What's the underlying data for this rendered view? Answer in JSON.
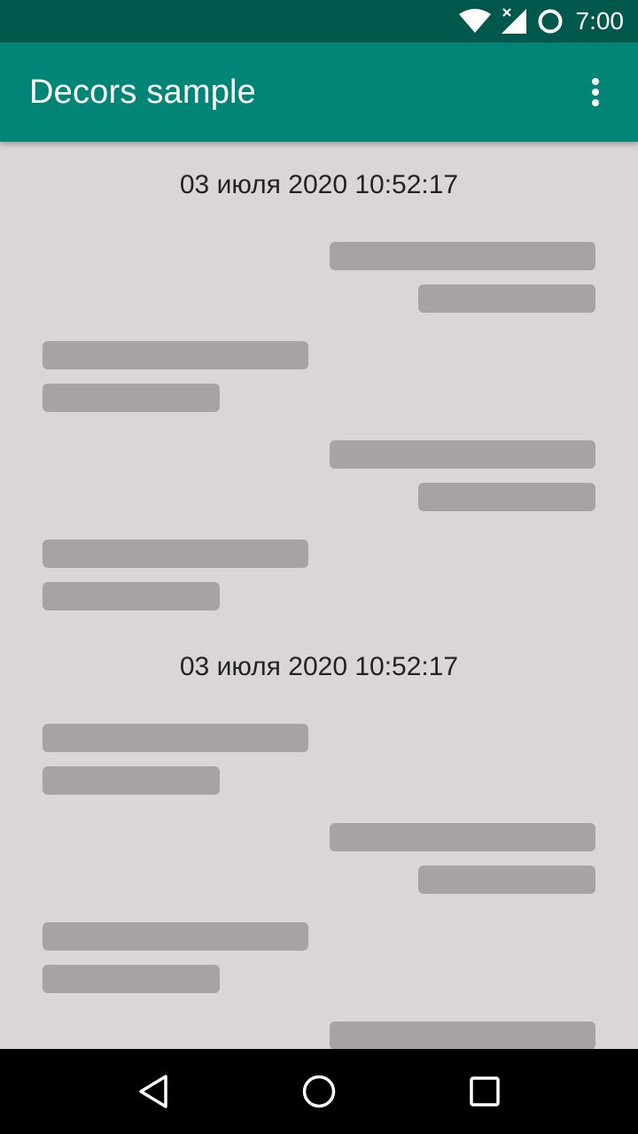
{
  "status_bar": {
    "time": "7:00",
    "icons": [
      "wifi-icon",
      "cell-signal-icon",
      "battery-icon"
    ]
  },
  "app_bar": {
    "title": "Decors sample",
    "menu_icon": "overflow-menu-icon"
  },
  "chat": {
    "groups": [
      {
        "date": "03 июля 2020 10:52:17",
        "messages": [
          "right",
          "left",
          "right",
          "left"
        ]
      },
      {
        "date": "03 июля 2020 10:52:17",
        "messages": [
          "left",
          "right",
          "left",
          "right"
        ]
      }
    ]
  },
  "nav_bar": {
    "buttons": [
      "back-icon",
      "home-icon",
      "recents-icon"
    ]
  },
  "colors": {
    "status_bar": "#00584c",
    "app_bar": "#008577",
    "background": "#dad6d6",
    "placeholder": "#a7a3a2"
  }
}
